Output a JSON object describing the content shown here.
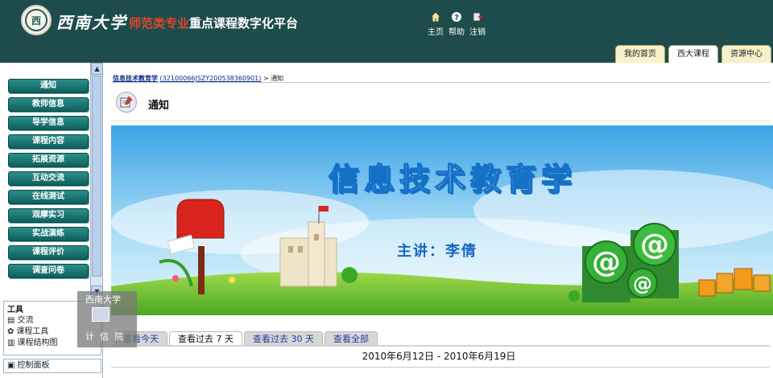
{
  "header": {
    "school_name": "西南大学",
    "platform_title_red": "师范类专业",
    "platform_title_rest": "重点课程数字化平台",
    "links": [
      {
        "label": "主页",
        "icon": "home-icon"
      },
      {
        "label": "帮助",
        "icon": "help-icon"
      },
      {
        "label": "注销",
        "icon": "logout-icon"
      }
    ],
    "tabs": [
      {
        "label": "我的首页",
        "active": false
      },
      {
        "label": "西大课程",
        "active": true
      },
      {
        "label": "资源中心",
        "active": false
      }
    ]
  },
  "sidebar": {
    "menu": [
      "通知",
      "教师信息",
      "导学信息",
      "课程内容",
      "拓展资源",
      "互动交流",
      "在线测试",
      "观摩实习",
      "实战演练",
      "课程评价",
      "调查问卷"
    ],
    "tools_title": "工具",
    "tools": [
      {
        "label": "交流",
        "icon": "chat-icon"
      },
      {
        "label": "课程工具",
        "icon": "tools-icon"
      },
      {
        "label": "课程结构图",
        "icon": "map-icon"
      }
    ],
    "control_panel": "控制面板"
  },
  "watermark": {
    "top": "西南大学",
    "bottom": "计信院"
  },
  "main": {
    "breadcrumb_course": "信息技术教育学",
    "breadcrumb_code": "(32100066JSZY200538360901)",
    "breadcrumb_sep": ">",
    "breadcrumb_current": "通知",
    "page_title": "通知",
    "banner": {
      "title": "信息技术教育学",
      "lecturer": "主讲：李倩"
    },
    "date_tabs": [
      {
        "label": "查看今天",
        "active": false
      },
      {
        "label": "查看过去 7 天",
        "active": true
      },
      {
        "label": "查看过去 30 天",
        "active": false
      },
      {
        "label": "查看全部",
        "active": false
      }
    ],
    "date_range": "2010年6月12日 - 2010年6月19日"
  },
  "colors": {
    "header_bg": "#1e4c4c",
    "menu_button": "#1a706c",
    "title_red": "#e0452e",
    "banner_sky": "#5fb6ea"
  }
}
